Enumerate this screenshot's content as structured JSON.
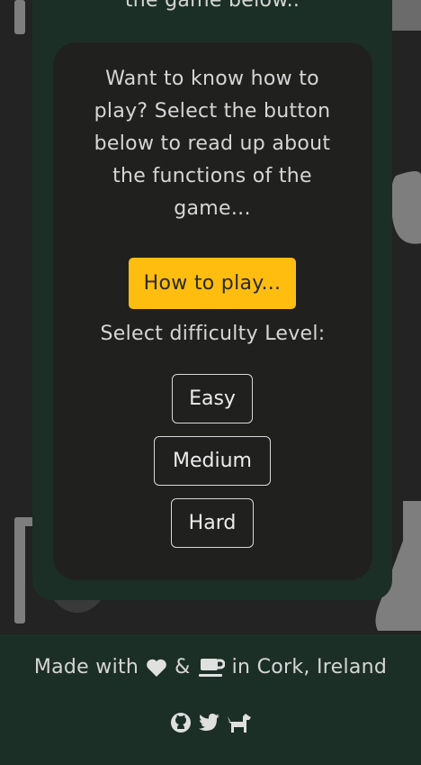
{
  "header": {
    "top_text": "the game below.."
  },
  "intro": {
    "text": "Want to know how to play? Select the button below to read up about the functions of the game..."
  },
  "howto": {
    "label": "How to play..."
  },
  "difficulty": {
    "label": "Select difficulty Level:",
    "options": [
      "Easy",
      "Medium",
      "Hard"
    ]
  },
  "footer": {
    "made_with": "Made with",
    "amp": "&",
    "location": "in Cork, Ireland",
    "icons": [
      "heart-icon",
      "coffee-icon",
      "github-icon",
      "twitter-icon",
      "dog-icon"
    ]
  },
  "colors": {
    "page_bg": "#222322",
    "panel_bg": "#1c2f27",
    "card_bg": "#20211f",
    "accent": "#ffbd10",
    "text": "#d6d6d6"
  }
}
